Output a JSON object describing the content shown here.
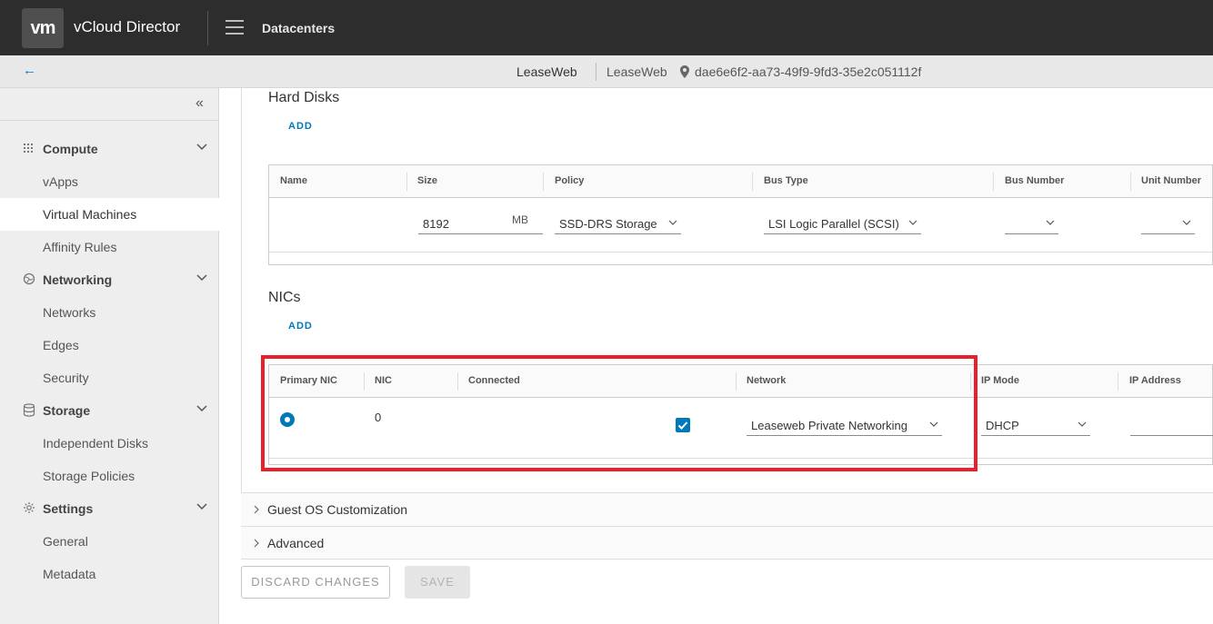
{
  "header": {
    "logo_text": "vm",
    "app_title": "vCloud Director",
    "nav_label": "Datacenters"
  },
  "context": {
    "back_symbol": "←",
    "org": "LeaseWeb",
    "vdc": "LeaseWeb",
    "vdc_id": "dae6e6f2-aa73-49f9-9fd3-35e2c051112f"
  },
  "sidebar": {
    "collapse_symbol": "«",
    "groups": [
      {
        "label": "Compute",
        "icon": "grid-icon",
        "items": [
          "vApps",
          "Virtual Machines",
          "Affinity Rules"
        ]
      },
      {
        "label": "Networking",
        "icon": "globe-icon",
        "items": [
          "Networks",
          "Edges",
          "Security"
        ]
      },
      {
        "label": "Storage",
        "icon": "database-icon",
        "items": [
          "Independent Disks",
          "Storage Policies"
        ]
      },
      {
        "label": "Settings",
        "icon": "gear-icon",
        "items": [
          "General",
          "Metadata"
        ]
      }
    ],
    "active_item": "Virtual Machines"
  },
  "hard_disks": {
    "title": "Hard Disks",
    "add_label": "ADD",
    "columns": [
      "Name",
      "Size",
      "Policy",
      "Bus Type",
      "Bus Number",
      "Unit Number"
    ],
    "row": {
      "name": "",
      "size": "8192",
      "size_unit": "MB",
      "policy": "SSD-DRS Storage",
      "bus_type": "LSI Logic Parallel (SCSI)",
      "bus_number": "",
      "unit_number": ""
    }
  },
  "nics": {
    "title": "NICs",
    "add_label": "ADD",
    "columns": [
      "Primary NIC",
      "NIC",
      "Connected",
      "Network",
      "IP Mode",
      "IP Address"
    ],
    "row": {
      "primary": true,
      "nic": "0",
      "connected": true,
      "network": "Leaseweb Private Networking",
      "ip_mode": "DHCP",
      "ip_address": ""
    }
  },
  "sections": {
    "guest_os": "Guest OS Customization",
    "advanced": "Advanced"
  },
  "buttons": {
    "discard": "DISCARD CHANGES",
    "save": "SAVE"
  },
  "colors": {
    "accent": "#0079b8",
    "header_bg": "#2d2d2d",
    "highlight": "#e8202a"
  }
}
